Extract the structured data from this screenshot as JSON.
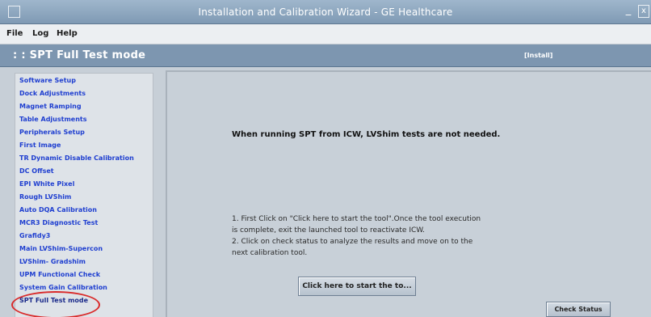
{
  "window": {
    "title": "Installation and Calibration Wizard - GE Healthcare",
    "minimize_glyph": "_",
    "close_glyph": "x"
  },
  "menu": {
    "items": [
      "File",
      "Log",
      "Help"
    ]
  },
  "header": {
    "title": ": : SPT Full Test mode",
    "install_link": "[Install]"
  },
  "sidebar": {
    "items": [
      {
        "label": "Software Setup"
      },
      {
        "label": "Dock Adjustments"
      },
      {
        "label": "Magnet Ramping"
      },
      {
        "label": "Table Adjustments"
      },
      {
        "label": "Peripherals Setup"
      },
      {
        "label": "First Image"
      },
      {
        "label": "TR Dynamic Disable Calibration"
      },
      {
        "label": "DC Offset"
      },
      {
        "label": "EPI White Pixel"
      },
      {
        "label": "Rough LVShim"
      },
      {
        "label": "Auto DQA Calibration"
      },
      {
        "label": "MCR3 Diagnostic Test"
      },
      {
        "label": "Grafidy3"
      },
      {
        "label": "Main LVShim-Supercon"
      },
      {
        "label": "LVShim- Gradshim"
      },
      {
        "label": "UPM Functional Check"
      },
      {
        "label": "System Gain Calibration"
      },
      {
        "label": "SPT Full Test mode"
      }
    ],
    "selected_index": 17
  },
  "main": {
    "message": "When running SPT from ICW, LVShim tests are not needed.",
    "instructions": [
      "1. First Click on \"Click here to start the tool\".Once the tool execution",
      "is complete, exit the launched tool to reactivate ICW.",
      "2. Click on check status to analyze the results and move on to the",
      "next calibration tool."
    ],
    "start_button_label": "Click here to start the to...",
    "check_status_label": "Check Status"
  },
  "colors": {
    "titlebar": "#8ea7c0",
    "header": "#7d96b0",
    "sidebar_link": "#1f3fd0",
    "panel": "#c8d0d8",
    "highlight": "#d92b2b"
  }
}
